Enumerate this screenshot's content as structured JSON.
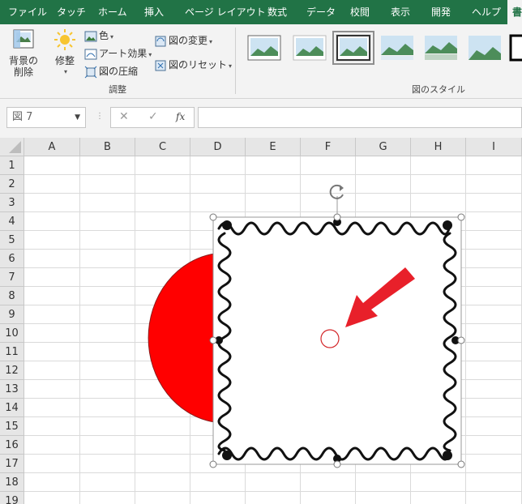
{
  "ribbon_tabs": [
    {
      "label": "ファイル",
      "active": false
    },
    {
      "label": "タッチ",
      "active": false
    },
    {
      "label": "ホーム",
      "active": false
    },
    {
      "label": "挿入",
      "active": false
    },
    {
      "label": "ページ レイアウト",
      "active": false
    },
    {
      "label": "数式",
      "active": false
    },
    {
      "label": "データ",
      "active": false
    },
    {
      "label": "校閲",
      "active": false
    },
    {
      "label": "表示",
      "active": false
    },
    {
      "label": "開発",
      "active": false
    },
    {
      "label": "ヘルプ",
      "active": false
    },
    {
      "label": "書",
      "active": true
    }
  ],
  "ribbon": {
    "remove_background": "背景の\n削除",
    "corrections": "修整",
    "color": "色",
    "artistic_effects": "アート効果",
    "compress": "図の圧縮",
    "change_picture": "図の変更",
    "reset_picture": "図のリセット",
    "adjust_group": "調整",
    "styles_group": "図のスタイル"
  },
  "formula_bar": {
    "name_box": "図 7",
    "fx_label": "fx",
    "formula": ""
  },
  "columns": [
    "A",
    "B",
    "C",
    "D",
    "E",
    "F",
    "G",
    "H",
    "I"
  ],
  "rows": [
    "1",
    "2",
    "3",
    "4",
    "5",
    "6",
    "7",
    "8",
    "9",
    "10",
    "11",
    "12",
    "13",
    "14",
    "15",
    "16",
    "17",
    "18",
    "19"
  ],
  "colors": {
    "tab_green": "#217346",
    "shape_red": "#ff0000",
    "arrow_red": "#e8202a"
  }
}
